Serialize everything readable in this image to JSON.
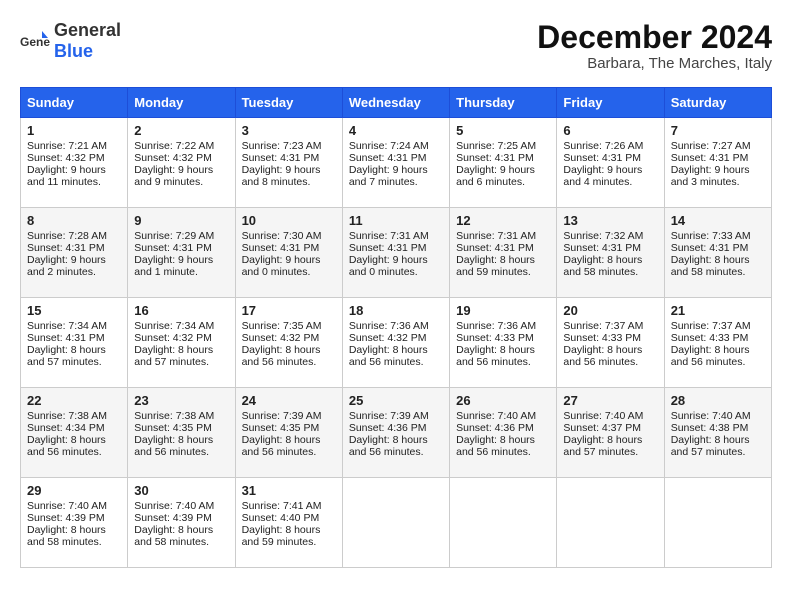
{
  "header": {
    "logo_general": "General",
    "logo_blue": "Blue",
    "month_year": "December 2024",
    "location": "Barbara, The Marches, Italy"
  },
  "days_of_week": [
    "Sunday",
    "Monday",
    "Tuesday",
    "Wednesday",
    "Thursday",
    "Friday",
    "Saturday"
  ],
  "weeks": [
    [
      {
        "date": "1",
        "sunrise": "Sunrise: 7:21 AM",
        "sunset": "Sunset: 4:32 PM",
        "daylight": "Daylight: 9 hours and 11 minutes."
      },
      {
        "date": "2",
        "sunrise": "Sunrise: 7:22 AM",
        "sunset": "Sunset: 4:32 PM",
        "daylight": "Daylight: 9 hours and 9 minutes."
      },
      {
        "date": "3",
        "sunrise": "Sunrise: 7:23 AM",
        "sunset": "Sunset: 4:31 PM",
        "daylight": "Daylight: 9 hours and 8 minutes."
      },
      {
        "date": "4",
        "sunrise": "Sunrise: 7:24 AM",
        "sunset": "Sunset: 4:31 PM",
        "daylight": "Daylight: 9 hours and 7 minutes."
      },
      {
        "date": "5",
        "sunrise": "Sunrise: 7:25 AM",
        "sunset": "Sunset: 4:31 PM",
        "daylight": "Daylight: 9 hours and 6 minutes."
      },
      {
        "date": "6",
        "sunrise": "Sunrise: 7:26 AM",
        "sunset": "Sunset: 4:31 PM",
        "daylight": "Daylight: 9 hours and 4 minutes."
      },
      {
        "date": "7",
        "sunrise": "Sunrise: 7:27 AM",
        "sunset": "Sunset: 4:31 PM",
        "daylight": "Daylight: 9 hours and 3 minutes."
      }
    ],
    [
      {
        "date": "8",
        "sunrise": "Sunrise: 7:28 AM",
        "sunset": "Sunset: 4:31 PM",
        "daylight": "Daylight: 9 hours and 2 minutes."
      },
      {
        "date": "9",
        "sunrise": "Sunrise: 7:29 AM",
        "sunset": "Sunset: 4:31 PM",
        "daylight": "Daylight: 9 hours and 1 minute."
      },
      {
        "date": "10",
        "sunrise": "Sunrise: 7:30 AM",
        "sunset": "Sunset: 4:31 PM",
        "daylight": "Daylight: 9 hours and 0 minutes."
      },
      {
        "date": "11",
        "sunrise": "Sunrise: 7:31 AM",
        "sunset": "Sunset: 4:31 PM",
        "daylight": "Daylight: 9 hours and 0 minutes."
      },
      {
        "date": "12",
        "sunrise": "Sunrise: 7:31 AM",
        "sunset": "Sunset: 4:31 PM",
        "daylight": "Daylight: 8 hours and 59 minutes."
      },
      {
        "date": "13",
        "sunrise": "Sunrise: 7:32 AM",
        "sunset": "Sunset: 4:31 PM",
        "daylight": "Daylight: 8 hours and 58 minutes."
      },
      {
        "date": "14",
        "sunrise": "Sunrise: 7:33 AM",
        "sunset": "Sunset: 4:31 PM",
        "daylight": "Daylight: 8 hours and 58 minutes."
      }
    ],
    [
      {
        "date": "15",
        "sunrise": "Sunrise: 7:34 AM",
        "sunset": "Sunset: 4:31 PM",
        "daylight": "Daylight: 8 hours and 57 minutes."
      },
      {
        "date": "16",
        "sunrise": "Sunrise: 7:34 AM",
        "sunset": "Sunset: 4:32 PM",
        "daylight": "Daylight: 8 hours and 57 minutes."
      },
      {
        "date": "17",
        "sunrise": "Sunrise: 7:35 AM",
        "sunset": "Sunset: 4:32 PM",
        "daylight": "Daylight: 8 hours and 56 minutes."
      },
      {
        "date": "18",
        "sunrise": "Sunrise: 7:36 AM",
        "sunset": "Sunset: 4:32 PM",
        "daylight": "Daylight: 8 hours and 56 minutes."
      },
      {
        "date": "19",
        "sunrise": "Sunrise: 7:36 AM",
        "sunset": "Sunset: 4:33 PM",
        "daylight": "Daylight: 8 hours and 56 minutes."
      },
      {
        "date": "20",
        "sunrise": "Sunrise: 7:37 AM",
        "sunset": "Sunset: 4:33 PM",
        "daylight": "Daylight: 8 hours and 56 minutes."
      },
      {
        "date": "21",
        "sunrise": "Sunrise: 7:37 AM",
        "sunset": "Sunset: 4:33 PM",
        "daylight": "Daylight: 8 hours and 56 minutes."
      }
    ],
    [
      {
        "date": "22",
        "sunrise": "Sunrise: 7:38 AM",
        "sunset": "Sunset: 4:34 PM",
        "daylight": "Daylight: 8 hours and 56 minutes."
      },
      {
        "date": "23",
        "sunrise": "Sunrise: 7:38 AM",
        "sunset": "Sunset: 4:35 PM",
        "daylight": "Daylight: 8 hours and 56 minutes."
      },
      {
        "date": "24",
        "sunrise": "Sunrise: 7:39 AM",
        "sunset": "Sunset: 4:35 PM",
        "daylight": "Daylight: 8 hours and 56 minutes."
      },
      {
        "date": "25",
        "sunrise": "Sunrise: 7:39 AM",
        "sunset": "Sunset: 4:36 PM",
        "daylight": "Daylight: 8 hours and 56 minutes."
      },
      {
        "date": "26",
        "sunrise": "Sunrise: 7:40 AM",
        "sunset": "Sunset: 4:36 PM",
        "daylight": "Daylight: 8 hours and 56 minutes."
      },
      {
        "date": "27",
        "sunrise": "Sunrise: 7:40 AM",
        "sunset": "Sunset: 4:37 PM",
        "daylight": "Daylight: 8 hours and 57 minutes."
      },
      {
        "date": "28",
        "sunrise": "Sunrise: 7:40 AM",
        "sunset": "Sunset: 4:38 PM",
        "daylight": "Daylight: 8 hours and 57 minutes."
      }
    ],
    [
      {
        "date": "29",
        "sunrise": "Sunrise: 7:40 AM",
        "sunset": "Sunset: 4:39 PM",
        "daylight": "Daylight: 8 hours and 58 minutes."
      },
      {
        "date": "30",
        "sunrise": "Sunrise: 7:40 AM",
        "sunset": "Sunset: 4:39 PM",
        "daylight": "Daylight: 8 hours and 58 minutes."
      },
      {
        "date": "31",
        "sunrise": "Sunrise: 7:41 AM",
        "sunset": "Sunset: 4:40 PM",
        "daylight": "Daylight: 8 hours and 59 minutes."
      },
      null,
      null,
      null,
      null
    ]
  ]
}
